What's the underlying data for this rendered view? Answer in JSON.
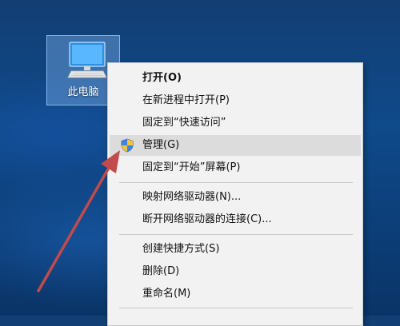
{
  "desktop": {
    "icon_label": "此电脑",
    "icon_name": "computer-icon"
  },
  "context_menu": {
    "items": [
      {
        "label": "打开(O)",
        "bold": true
      },
      {
        "label": "在新进程中打开(P)"
      },
      {
        "label": "固定到“快速访问”"
      },
      {
        "label": "管理(G)",
        "icon": "shield-icon",
        "highlighted": true
      },
      {
        "label": "固定到“开始”屏幕(P)"
      },
      {
        "label": "映射网络驱动器(N)..."
      },
      {
        "label": "断开网络驱动器的连接(C)..."
      },
      {
        "label": "创建快捷方式(S)"
      },
      {
        "label": "删除(D)"
      },
      {
        "label": "重命名(M)"
      }
    ]
  },
  "annotation": {
    "arrow_color": "#c24a4a",
    "arrow_target": "管理(G)"
  },
  "colors": {
    "desktop_background": "#0f4a8a",
    "menu_background": "#f2f2f2",
    "menu_highlight": "#dcdcdc"
  }
}
